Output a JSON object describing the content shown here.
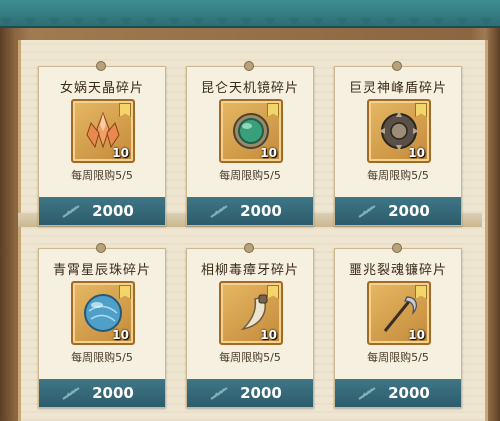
{
  "shop": {
    "items": [
      {
        "name": "女娲天晶碎片",
        "icon": "crystal-icon",
        "quantity": "10",
        "limit": "每周限购5/5",
        "price": "2000"
      },
      {
        "name": "昆仑天机镜碎片",
        "icon": "mirror-icon",
        "quantity": "10",
        "limit": "每周限购5/5",
        "price": "2000"
      },
      {
        "name": "巨灵神峰盾碎片",
        "icon": "shield-icon",
        "quantity": "10",
        "limit": "每周限购5/5",
        "price": "2000"
      },
      {
        "name": "青霄星辰珠碎片",
        "icon": "orb-icon",
        "quantity": "10",
        "limit": "每周限购5/5",
        "price": "2000"
      },
      {
        "name": "相柳毒瘴牙碎片",
        "icon": "fang-icon",
        "quantity": "10",
        "limit": "每周限购5/5",
        "price": "2000"
      },
      {
        "name": "噩兆裂魂镰碎片",
        "icon": "scythe-icon",
        "quantity": "10",
        "limit": "每周限购5/5",
        "price": "2000"
      }
    ],
    "colors": {
      "price_bar": "#2c5c6b",
      "slot_gold": "#c38a3a",
      "awning_teal": "#3e8e93"
    }
  }
}
